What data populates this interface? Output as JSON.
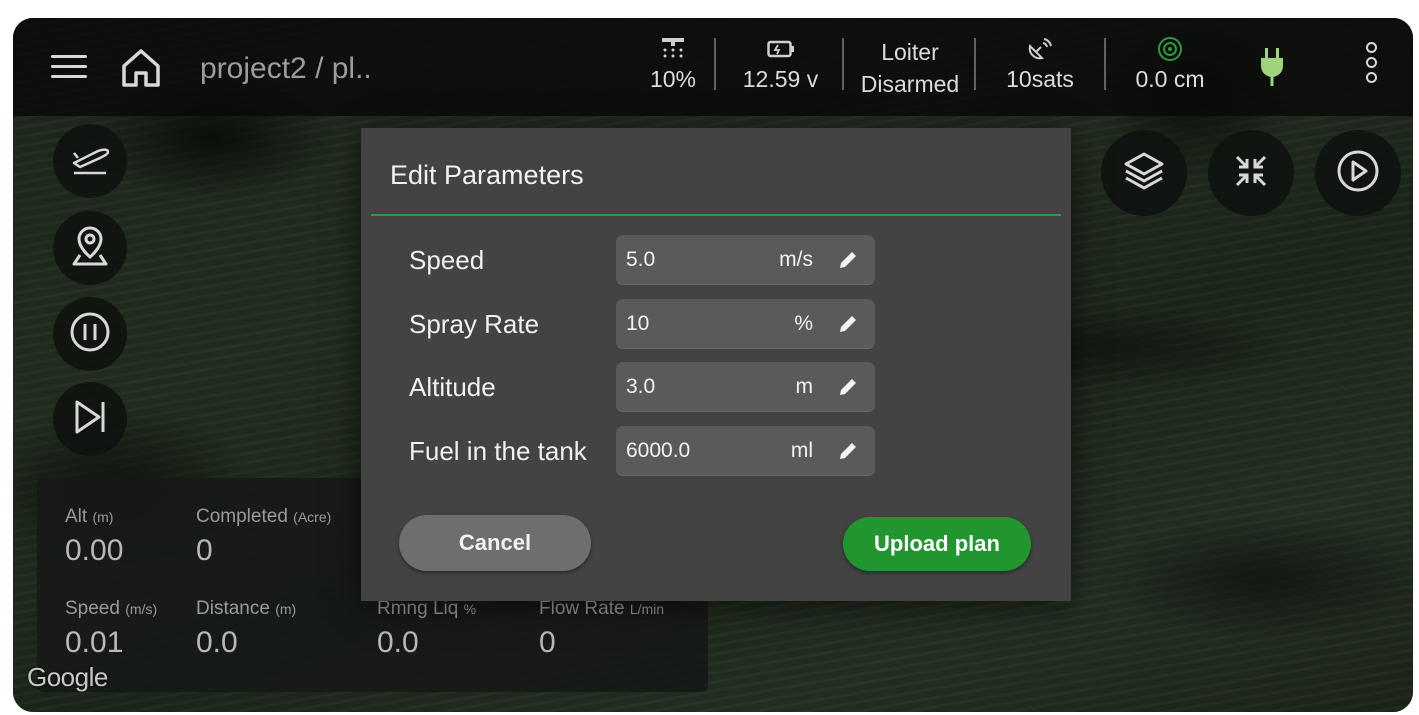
{
  "header": {
    "title": "project2 / pl..",
    "stats": {
      "spray": "10%",
      "battery": "12.59 v",
      "mode": "Loiter",
      "arm_state": "Disarmed",
      "gps": "10sats",
      "rangefinder": "0.0 cm"
    },
    "icons": {
      "menu": "hamburger-menu-icon",
      "home": "home-icon",
      "spray": "sprayer-icon",
      "battery": "battery-icon",
      "gps": "satellite-dish-icon",
      "rangefinder": "radar-icon",
      "power": "plug-icon",
      "more": "more-vertical-icon"
    }
  },
  "side_buttons": [
    "takeoff-icon",
    "location-pin-icon",
    "pause-circle-icon",
    "skip-forward-icon"
  ],
  "right_buttons": [
    "layers-icon",
    "collapse-icon",
    "play-circle-icon"
  ],
  "telemetry": {
    "alt": {
      "label": "Alt",
      "unit": "(m)",
      "value": "0.00"
    },
    "completed": {
      "label": "Completed",
      "unit": "(Acre)",
      "value": "0"
    },
    "speed": {
      "label": "Speed",
      "unit": "(m/s)",
      "value": "0.01"
    },
    "distance": {
      "label": "Distance",
      "unit": "(m)",
      "value": "0.0"
    },
    "remaining": {
      "label": "Rmng Liq",
      "unit": "%",
      "value": "0.0"
    },
    "flow": {
      "label": "Flow Rate",
      "unit": "L/min",
      "value": "0"
    }
  },
  "map_attribution": "Google",
  "dialog": {
    "title": "Edit Parameters",
    "params": [
      {
        "label": "Speed",
        "value": "5.0",
        "unit": "m/s"
      },
      {
        "label": "Spray Rate",
        "value": "10",
        "unit": "%"
      },
      {
        "label": "Altitude",
        "value": "3.0",
        "unit": "m"
      },
      {
        "label": "Fuel in the tank",
        "value": "6000.0",
        "unit": "ml"
      }
    ],
    "cancel_label": "Cancel",
    "upload_label": "Upload plan"
  },
  "colors": {
    "accent_green": "#22962e",
    "rule_green": "#2f9a36",
    "dialog_bg": "#434343",
    "field_bg": "#5a5a5a",
    "gps_green": "#2e9a3c",
    "plug_green": "#9fd47a"
  }
}
